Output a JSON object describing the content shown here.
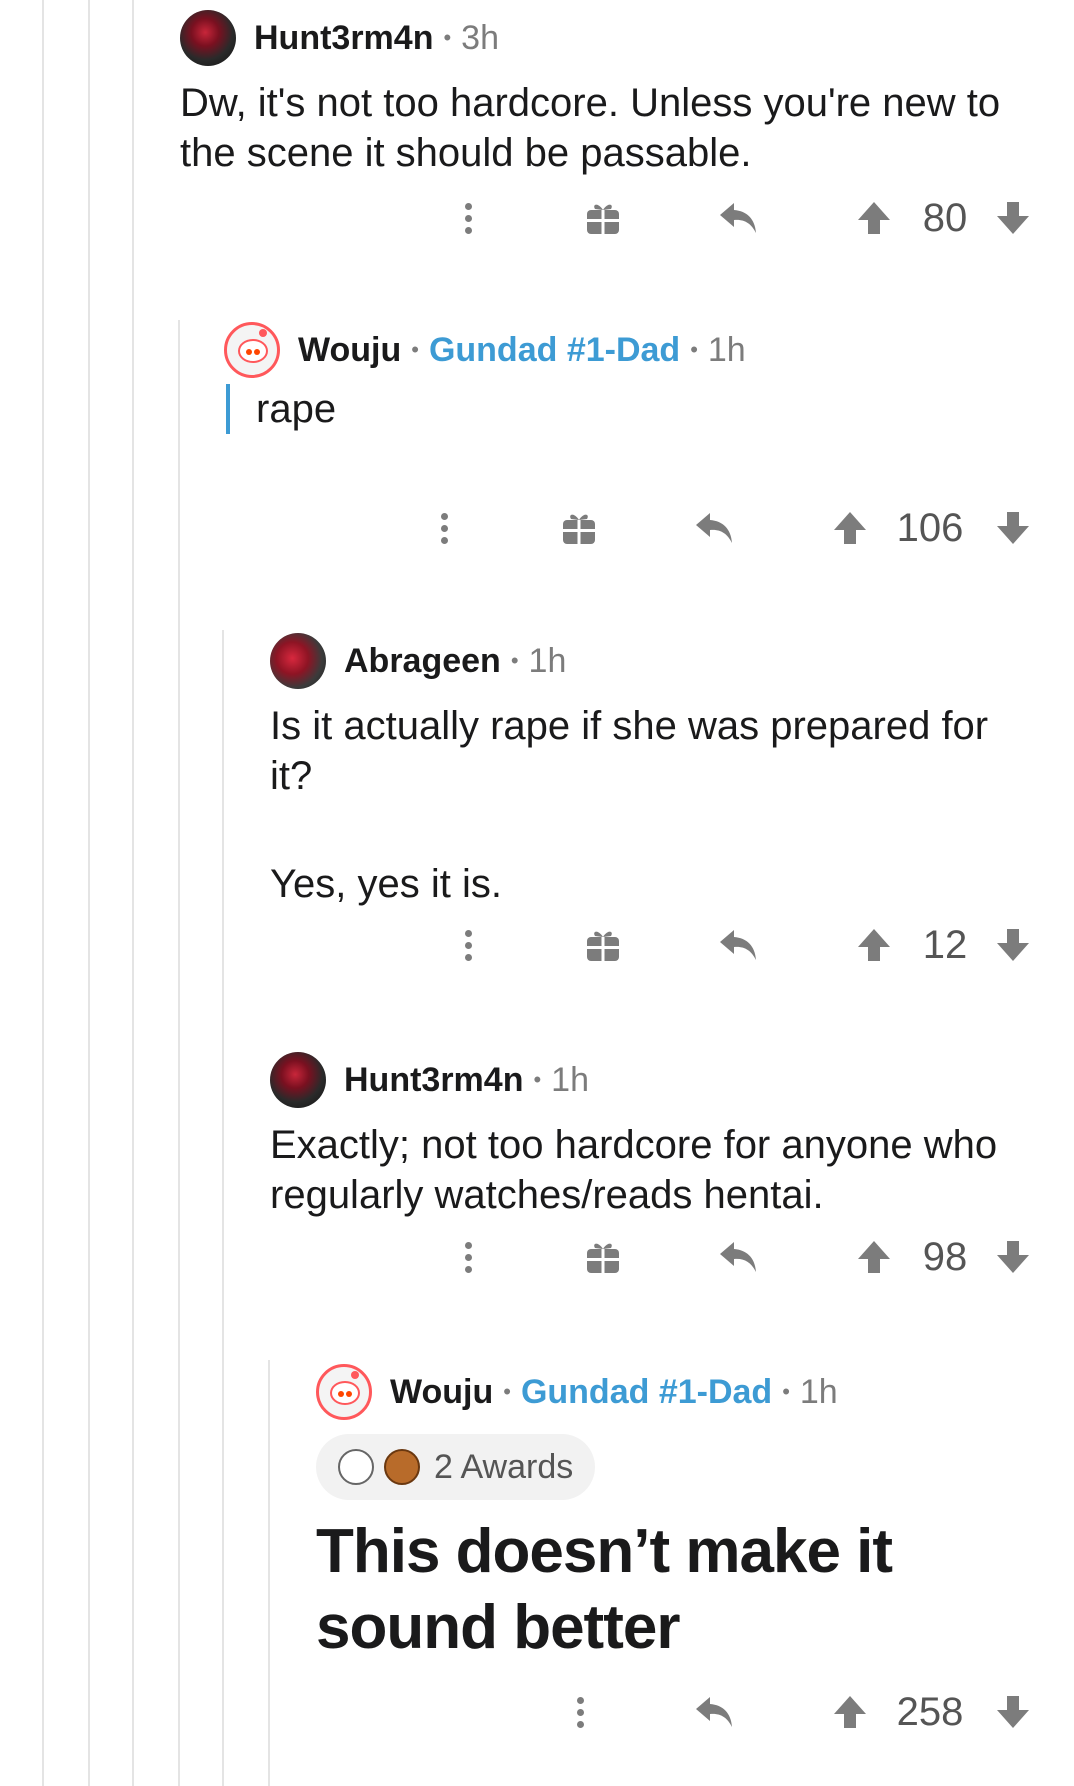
{
  "comments": [
    {
      "author": "Hunt3rm4n",
      "time": "3h",
      "lines": [
        "Dw, it's not too hardcore. Unless you're new to",
        "the scene it should be passable."
      ],
      "score": "80"
    },
    {
      "author": "Wouju",
      "flair": "Gundad #1-Dad",
      "time": "1h",
      "quote": "rape",
      "score": "106"
    },
    {
      "author": "Abrageen",
      "time": "1h",
      "lines": [
        "Is it actually rape if she was prepared for",
        "it?"
      ],
      "lines2": [
        "Yes, yes it is."
      ],
      "score": "12"
    },
    {
      "author": "Hunt3rm4n",
      "time": "1h",
      "lines": [
        "Exactly; not too hardcore for anyone who",
        "regularly watches/reads hentai."
      ],
      "score": "98"
    },
    {
      "author": "Wouju",
      "flair": "Gundad #1-Dad",
      "time": "1h",
      "awards": "2 Awards",
      "headline": [
        "This doesn’t make it",
        "sound better"
      ],
      "score": "258"
    }
  ],
  "separator": "•",
  "icons": {
    "more": "more-options-icon",
    "gift": "gift-award-icon",
    "reply": "reply-arrow-icon",
    "upvote": "upvote-arrow-icon",
    "downvote": "downvote-arrow-icon"
  },
  "colors": {
    "flair": "#3d9bd4",
    "thread_line": "#e4e4e4",
    "icon_gray": "#7c7c7c"
  }
}
